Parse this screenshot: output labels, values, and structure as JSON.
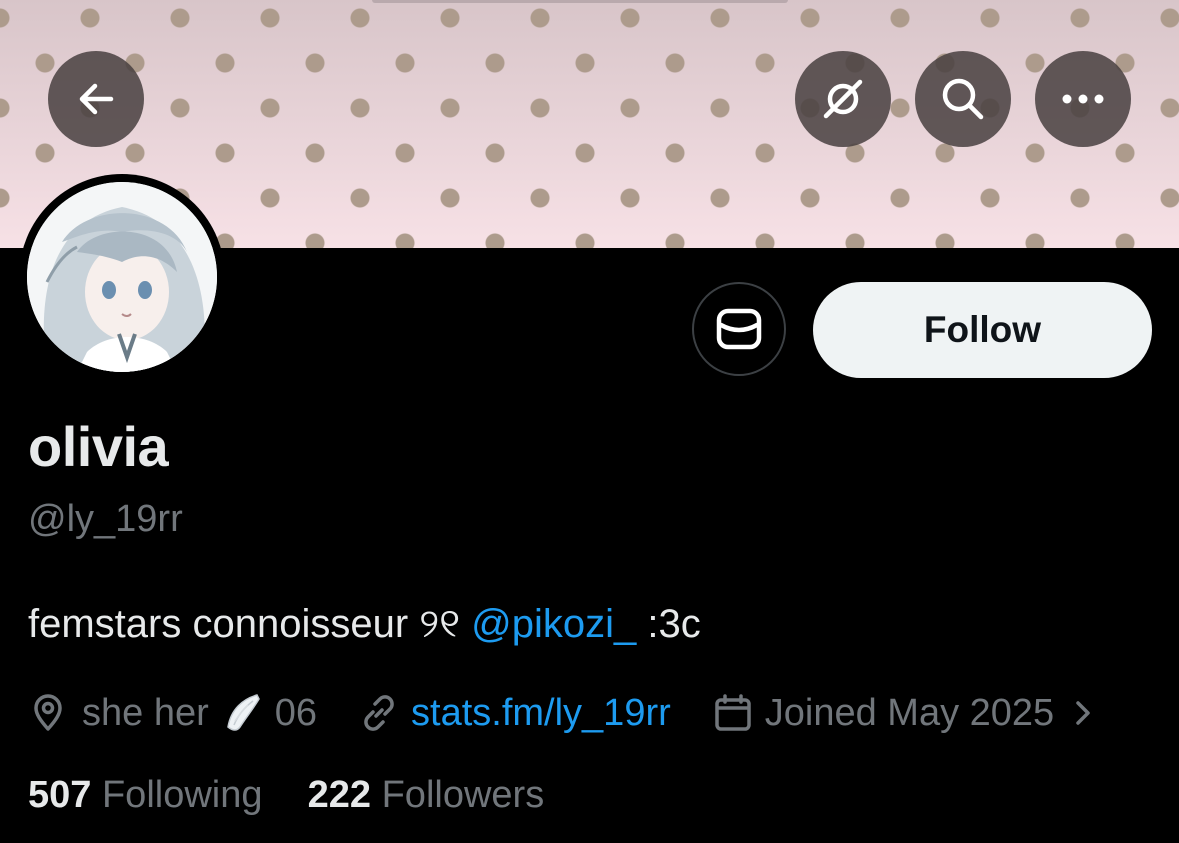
{
  "profile": {
    "name": "olivia",
    "handle": "@ly_19rr",
    "bio_text": "femstars connoisseur ୨୧ ",
    "bio_mention": "@pikozi_",
    "bio_suffix": " :3c",
    "location": "she her",
    "location_extra": "06",
    "website": "stats.fm/ly_19rr",
    "joined": "Joined May 2025",
    "following_count": "507",
    "following_label": "Following",
    "followers_count": "222",
    "followers_label": "Followers"
  },
  "actions": {
    "follow_label": "Follow"
  },
  "colors": {
    "link": "#1d9bf0",
    "muted": "#71767b",
    "text": "#e7e9ea",
    "background": "#000000",
    "follow_button_bg": "#eff3f4"
  },
  "icons": {
    "back": "arrow-left-icon",
    "grok": "slash-circle-icon",
    "search": "search-icon",
    "more": "more-horizontal-icon",
    "message": "envelope-icon",
    "location": "location-pin-icon",
    "link": "link-icon",
    "calendar": "calendar-icon",
    "chevron": "chevron-right-icon",
    "emoji": "wing-emoji"
  }
}
